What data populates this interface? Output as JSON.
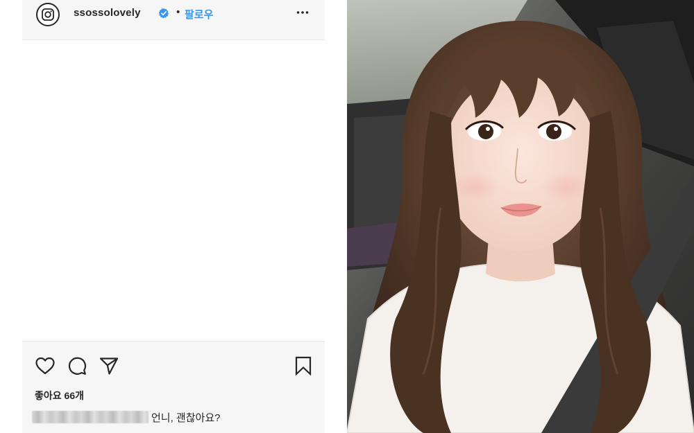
{
  "post": {
    "username": "ssossolovely",
    "separator": "•",
    "follow_label": "팔로우",
    "likes_label": "좋아요 66개",
    "comment_text": "언니, 괜찮아요?",
    "accent_color": "#3897f0",
    "icons": {
      "avatar": "instagram-logo-icon",
      "verified": "verified-badge-icon",
      "more": "more-options-icon",
      "like": "heart-icon",
      "comment": "comment-bubble-icon",
      "share": "paper-plane-icon",
      "save": "bookmark-icon"
    }
  }
}
